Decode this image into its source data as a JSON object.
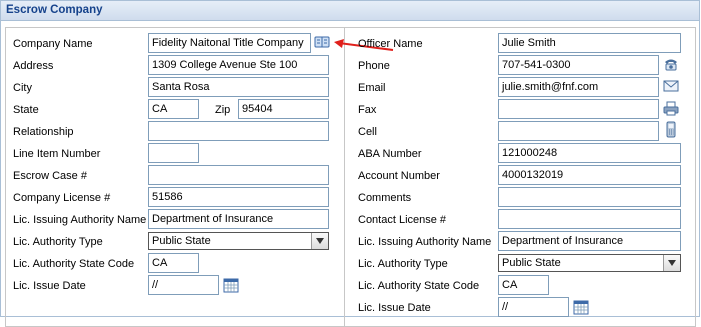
{
  "header": {
    "title": "Escrow Company"
  },
  "left": {
    "company_name": {
      "label": "Company Name",
      "value": "Fidelity Naitonal Title Company"
    },
    "address": {
      "label": "Address",
      "value": "1309 College Avenue Ste 100"
    },
    "city": {
      "label": "City",
      "value": "Santa Rosa"
    },
    "state": {
      "label": "State",
      "value": "CA"
    },
    "zip": {
      "label": "Zip",
      "value": "95404"
    },
    "relationship": {
      "label": "Relationship",
      "value": ""
    },
    "line_item_number": {
      "label": "Line Item Number",
      "value": ""
    },
    "escrow_case": {
      "label": "Escrow Case #",
      "value": ""
    },
    "company_license": {
      "label": "Company License #",
      "value": "51586"
    },
    "issuing_authority": {
      "label": "Lic. Issuing Authority Name",
      "value": "Department of Insurance"
    },
    "authority_type": {
      "label": "Lic. Authority Type",
      "value": "Public State"
    },
    "authority_state_code": {
      "label": "Lic. Authority State Code",
      "value": "CA"
    },
    "issue_date": {
      "label": "Lic. Issue Date",
      "value": "//"
    }
  },
  "right": {
    "officer_name": {
      "label": "Officer Name",
      "value": "Julie Smith"
    },
    "phone": {
      "label": "Phone",
      "value": "707-541-0300"
    },
    "email": {
      "label": "Email",
      "value": "julie.smith@fnf.com"
    },
    "fax": {
      "label": "Fax",
      "value": ""
    },
    "cell": {
      "label": "Cell",
      "value": ""
    },
    "aba_number": {
      "label": "ABA Number",
      "value": "121000248"
    },
    "account_number": {
      "label": "Account Number",
      "value": "4000132019"
    },
    "comments": {
      "label": "Comments",
      "value": ""
    },
    "contact_license": {
      "label": "Contact License #",
      "value": ""
    },
    "issuing_authority": {
      "label": "Lic. Issuing Authority Name",
      "value": "Department of Insurance"
    },
    "authority_type": {
      "label": "Lic. Authority Type",
      "value": "Public State"
    },
    "authority_state_code": {
      "label": "Lic. Authority State Code",
      "value": "CA"
    },
    "issue_date": {
      "label": "Lic. Issue Date",
      "value": "//"
    }
  },
  "icons": {
    "address_book": "address-book-icon",
    "phone": "phone-icon",
    "email": "email-icon",
    "fax": "fax-icon",
    "cell": "cell-phone-icon",
    "calendar": "calendar-icon"
  },
  "colors": {
    "header_text": "#15428b",
    "annotation_arrow": "#e0201c"
  }
}
